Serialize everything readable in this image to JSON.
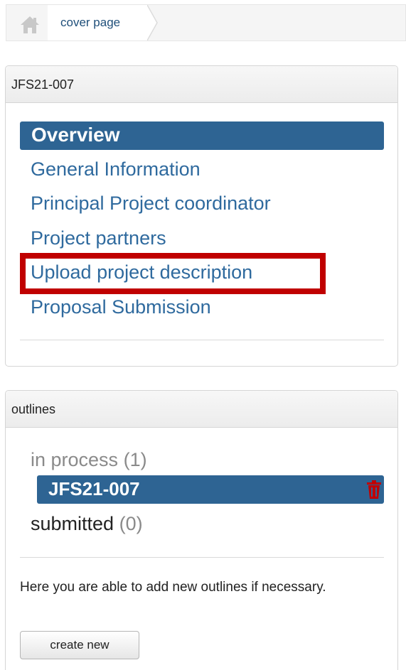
{
  "breadcrumb": {
    "home_icon": "home-icon",
    "item": "cover page"
  },
  "project_panel": {
    "title": "JFS21-007",
    "nav": {
      "active": "Overview",
      "links": [
        "General Information",
        "Principal Project coordinator",
        "Project partners",
        "Upload project description",
        "Proposal Submission"
      ]
    },
    "highlight_color": "#c00000"
  },
  "outlines_panel": {
    "title": "outlines",
    "in_process": {
      "label": "in process",
      "count": "(1)"
    },
    "item": {
      "label": "JFS21-007",
      "delete_icon": "trash-icon"
    },
    "submitted": {
      "label": "submitted",
      "count": "(0)"
    },
    "info": "Here you are able to add new outlines if necessary.",
    "create_button": "create new"
  },
  "colors": {
    "active_bg": "#2e6493",
    "link": "#2f6a9e",
    "delete": "#c00000"
  }
}
